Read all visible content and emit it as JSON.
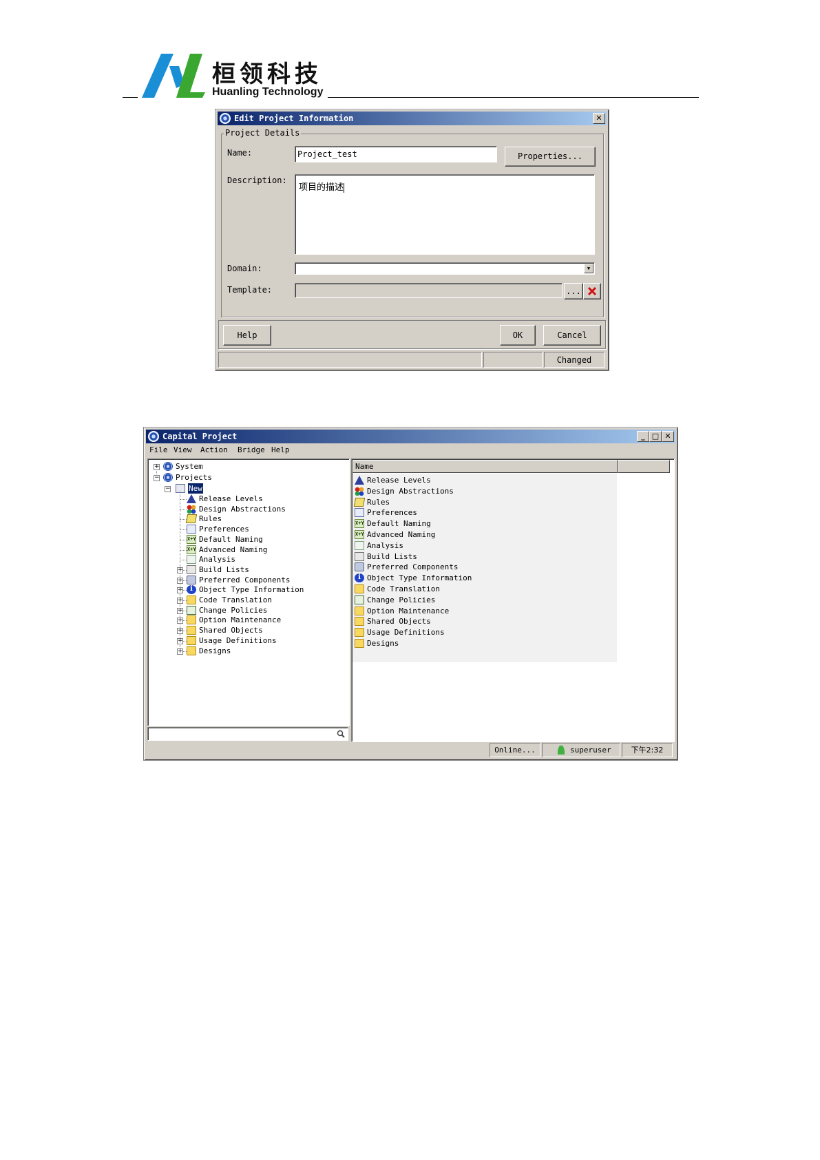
{
  "header": {
    "brand_cn": "桓领科技",
    "brand_en": "Huanling Technology",
    "colors": {
      "logo_blue": "#1b8fd6",
      "logo_green": "#3aa830"
    }
  },
  "dialog": {
    "title": "Edit Project Information",
    "group_title": "Project Details",
    "name_label": "Name:",
    "name_value": "Project_test",
    "properties_button": "Properties...",
    "description_label": "Description:",
    "description_value": "项目的描述",
    "domain_label": "Domain:",
    "domain_value": "",
    "template_label": "Template:",
    "template_value": "",
    "browse_button": "...",
    "help_button": "Help",
    "ok_button": "OK",
    "cancel_button": "Cancel",
    "status_changed": "Changed",
    "close_glyph": "✕"
  },
  "app": {
    "title": "Capital Project",
    "menu": [
      "File",
      "View",
      "Action",
      "Bridge",
      "Help"
    ],
    "tree": {
      "system": "System",
      "projects": "Projects",
      "selected": "New",
      "children": [
        {
          "label": "Release Levels",
          "icon": "release-levels-icon",
          "expandable": false
        },
        {
          "label": "Design Abstractions",
          "icon": "design-abstractions-icon",
          "expandable": false
        },
        {
          "label": "Rules",
          "icon": "rules-icon",
          "expandable": false
        },
        {
          "label": "Preferences",
          "icon": "preferences-icon",
          "expandable": false
        },
        {
          "label": "Default Naming",
          "icon": "naming-icon",
          "expandable": false
        },
        {
          "label": "Advanced Naming",
          "icon": "naming-icon",
          "expandable": false
        },
        {
          "label": "Analysis",
          "icon": "analysis-icon",
          "expandable": false
        },
        {
          "label": "Build Lists",
          "icon": "build-lists-icon",
          "expandable": true
        },
        {
          "label": "Preferred Components",
          "icon": "components-icon",
          "expandable": true
        },
        {
          "label": "Object Type Information",
          "icon": "info-icon",
          "expandable": true
        },
        {
          "label": "Code Translation",
          "icon": "folder-icon",
          "expandable": true
        },
        {
          "label": "Change Policies",
          "icon": "change-policies-icon",
          "expandable": true
        },
        {
          "label": "Option Maintenance",
          "icon": "folder-icon",
          "expandable": true
        },
        {
          "label": "Shared Objects",
          "icon": "folder-icon",
          "expandable": true
        },
        {
          "label": "Usage Definitions",
          "icon": "folder-icon",
          "expandable": true
        },
        {
          "label": "Designs",
          "icon": "folder-icon",
          "expandable": true
        }
      ]
    },
    "list": {
      "column_name": "Name",
      "items": [
        "Release Levels",
        "Design Abstractions",
        "Rules",
        "Preferences",
        "Default Naming",
        "Advanced Naming",
        "Analysis",
        "Build Lists",
        "Preferred Components",
        "Object Type Information",
        "Code Translation",
        "Change Policies",
        "Option Maintenance",
        "Shared Objects",
        "Usage Definitions",
        "Designs"
      ]
    },
    "status": {
      "online": "Online...",
      "user": "superuser",
      "time": "下午2:32"
    }
  }
}
